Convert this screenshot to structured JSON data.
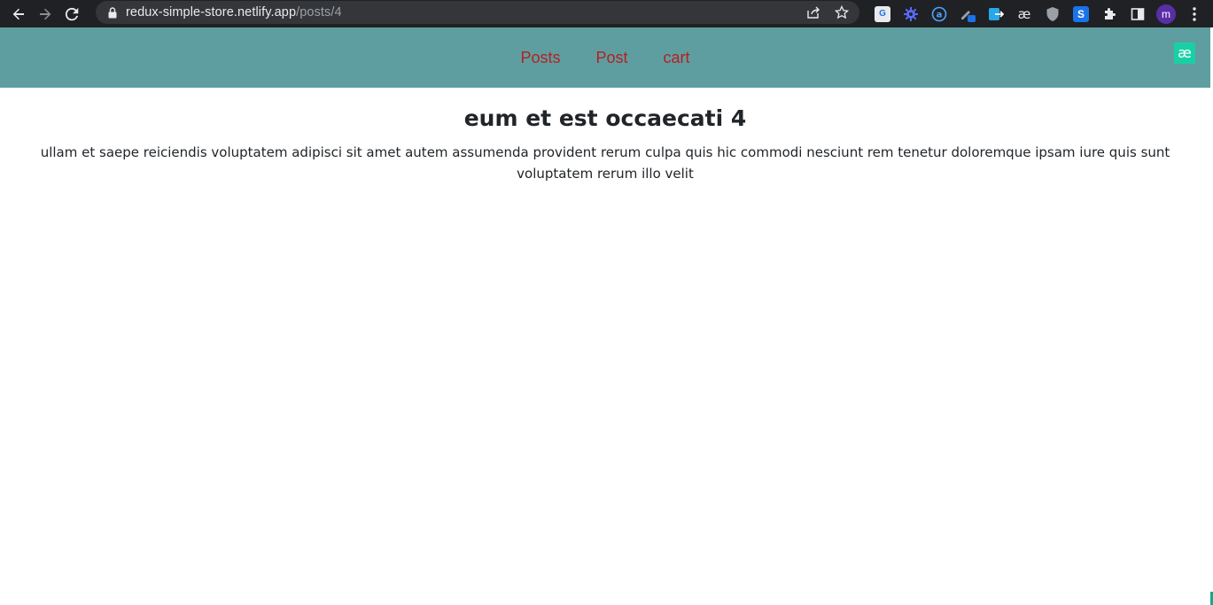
{
  "browser": {
    "url_host": "redux-simple-store.netlify.app",
    "url_path": "/posts/4",
    "avatar_initial": "m",
    "extensions": [
      "translate-icon",
      "gear-extension-icon",
      "a-circle-icon",
      "pen-extension-icon",
      "arrow-box-icon",
      "ae-extension-icon",
      "shield-icon",
      "s-extension-icon",
      "puzzle-icon",
      "side-panel-icon"
    ]
  },
  "nav": {
    "links": [
      "Posts",
      "Post",
      "cart"
    ],
    "badge": "æ"
  },
  "post": {
    "title": "eum et est occaecati 4",
    "body": "ullam et saepe reiciendis voluptatem adipisci sit amet autem assumenda provident rerum culpa quis hic commodi nesciunt rem tenetur doloremque ipsam iure quis sunt voluptatem rerum illo velit"
  },
  "colors": {
    "nav_bg": "#5f9ea0",
    "nav_link": "#b22222",
    "badge_bg": "#19d0a6"
  }
}
